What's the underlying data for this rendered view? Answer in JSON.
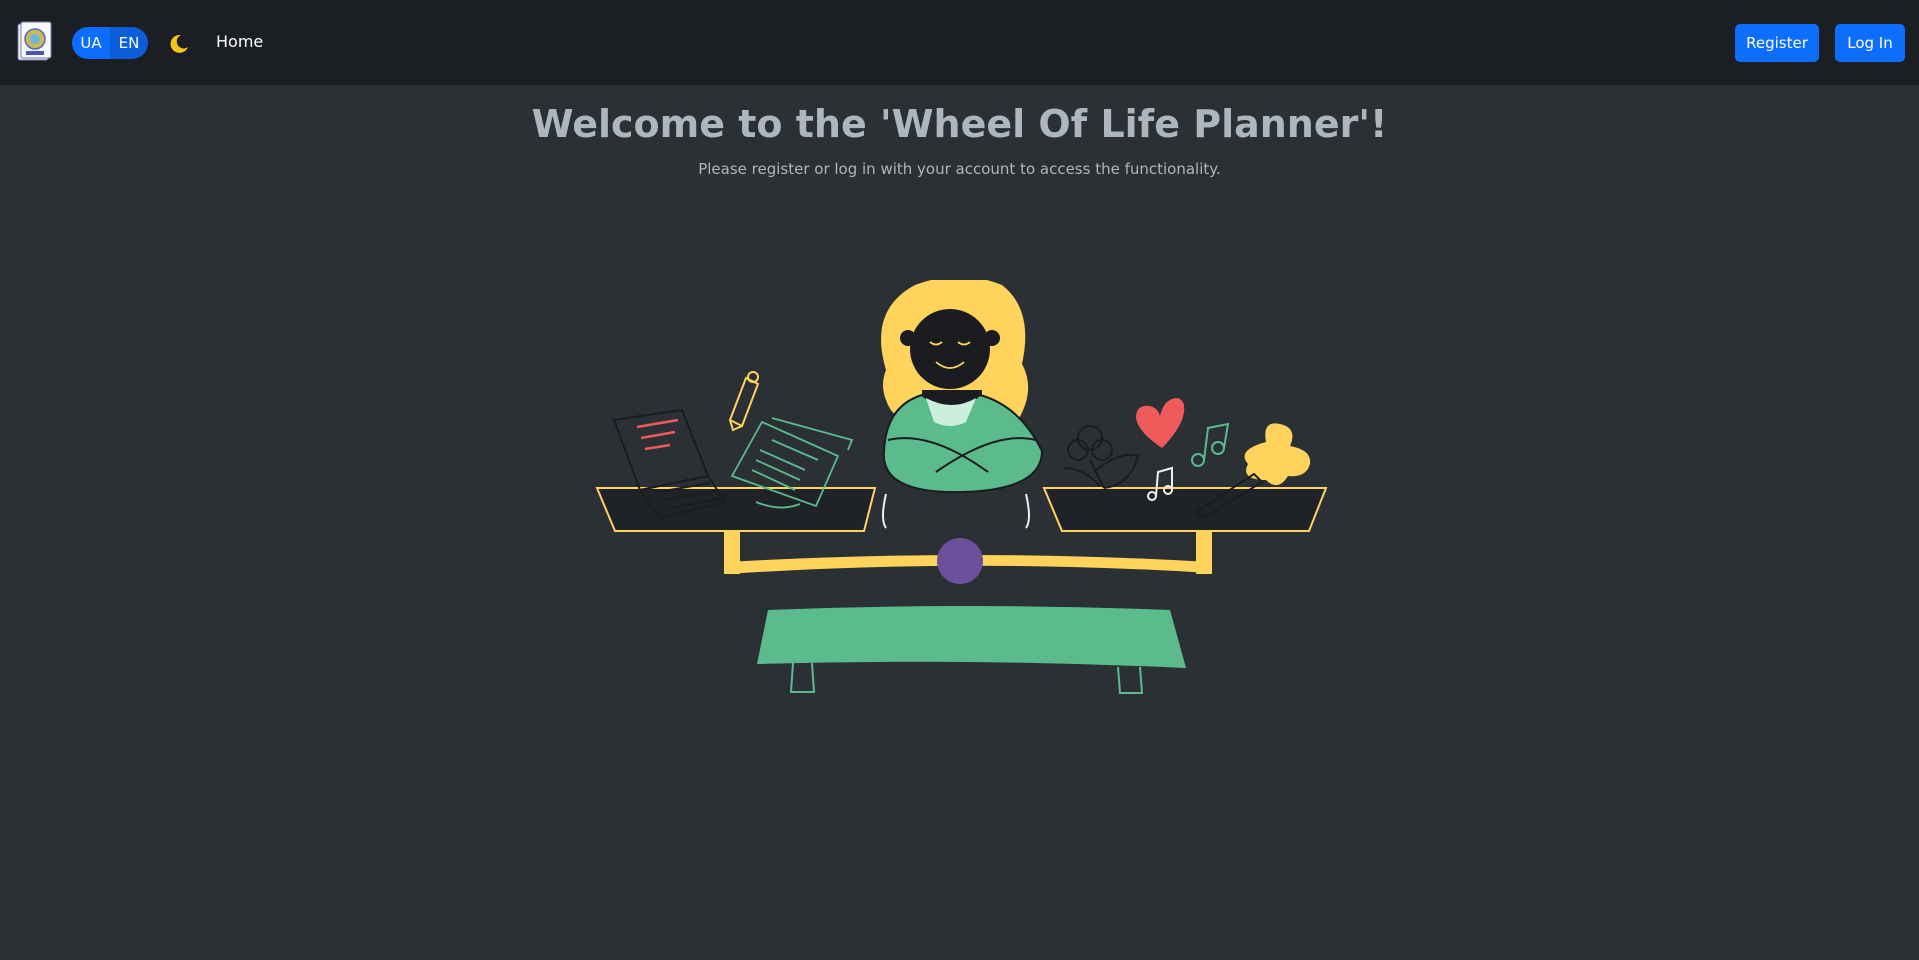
{
  "navbar": {
    "logo_icon": "wheel-of-life-logo-icon",
    "languages": [
      {
        "label": "UA",
        "active": true
      },
      {
        "label": "EN",
        "active": false
      }
    ],
    "theme_icon": "moon-icon",
    "home_label": "Home",
    "register_label": "Register",
    "login_label": "Log In"
  },
  "main": {
    "title": "Welcome to the 'Wheel Of Life Planner'!",
    "subtitle": "Please register or log in with your account to access the functionality.",
    "illustration_icon": "work-life-balance-scale-illustration"
  },
  "colors": {
    "navbar_bg": "#1b1e22",
    "page_bg": "#2b3035",
    "primary": "#0d6efd",
    "text_muted": "#adb5bd",
    "accent_yellow": "#ffd35c",
    "accent_green": "#5bbb8c",
    "accent_purple": "#6d4f9b",
    "accent_red": "#ef5b5b"
  }
}
